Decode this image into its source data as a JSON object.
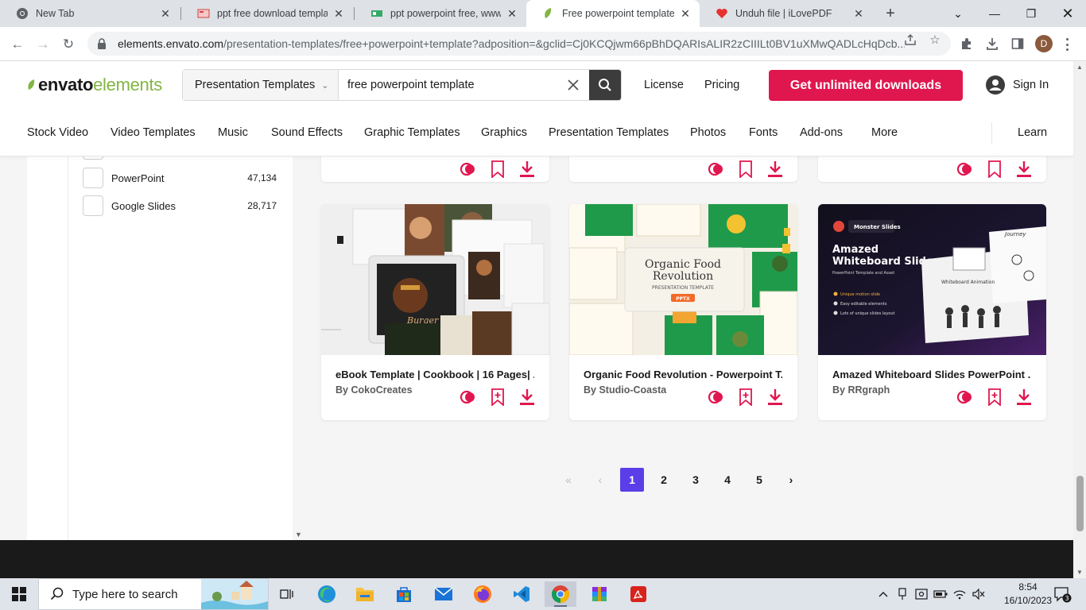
{
  "browser": {
    "tabs": [
      {
        "title": "New Tab",
        "icon": "chrome-icon"
      },
      {
        "title": "ppt free download template",
        "icon": "slides-favicon"
      },
      {
        "title": "ppt powerpoint free, www.al",
        "icon": "site-favicon"
      },
      {
        "title": "Free powerpoint template P",
        "icon": "envato-leaf-icon"
      },
      {
        "title": "Unduh file | iLovePDF",
        "icon": "ilovepdf-heart-icon"
      }
    ],
    "url_host": "elements.envato.com",
    "url_rest": "/presentation-templates/free+powerpoint+template?adposition=&gclid=Cj0KCQjwm66pBhDQARIsALIR2zCIIILt0BV1uXMwQADLcHqDcb...",
    "profile_initial": "D"
  },
  "header": {
    "logo_bold": "envato",
    "logo_light": "elements",
    "category": "Presentation Templates",
    "search_value": "free powerpoint template",
    "license": "License",
    "pricing": "Pricing",
    "cta": "Get unlimited downloads",
    "signin": "Sign In"
  },
  "nav": [
    "Stock Video",
    "Video Templates",
    "Music",
    "Sound Effects",
    "Graphic Templates",
    "Graphics",
    "Presentation Templates",
    "Photos",
    "Fonts",
    "Add-ons",
    "More"
  ],
  "nav_learn": "Learn",
  "filters": [
    {
      "label": "PowerPoint",
      "count": "47,134"
    },
    {
      "label": "Google Slides",
      "count": "28,717"
    }
  ],
  "cards": [
    {
      "title": "eBook Template | Cookbook | 16 Pages| ...",
      "by": "By",
      "author": "CokoCreates"
    },
    {
      "title": "Organic Food Revolution - Powerpoint T...",
      "by": "By",
      "author": "Studio-Coasta"
    },
    {
      "title": "Amazed Whiteboard Slides PowerPoint ...",
      "by": "By",
      "author": "RRgraph"
    }
  ],
  "thumbs": {
    "organic_title_1": "Organic Food",
    "organic_title_2": "Revolution",
    "organic_sub": "PRESENTATION TEMPLATE",
    "organic_badge": "PPTX",
    "monster_badge": "Monster Slides",
    "amazed_title_1": "Amazed",
    "amazed_title_2": "Whiteboard Slides",
    "amazed_sub": "PowerPoint Template and Asset",
    "amazed_b1": "Unique motion slide",
    "amazed_b2": "Easy editable elements",
    "amazed_b3": "Lots of unique slides layout",
    "journey": "Journey",
    "wb_anim": "Whiteboard Animation",
    "burger": "Burger"
  },
  "pagination": {
    "pages": [
      "1",
      "2",
      "3",
      "4",
      "5"
    ],
    "current": "1"
  },
  "taskbar": {
    "search_placeholder": "Type here to search",
    "time": "8:54",
    "date": "16/10/2023",
    "notifications": "3"
  },
  "colors": {
    "accent": "#e0174f",
    "envato_green": "#82b541",
    "pager": "#5b3ee8"
  }
}
